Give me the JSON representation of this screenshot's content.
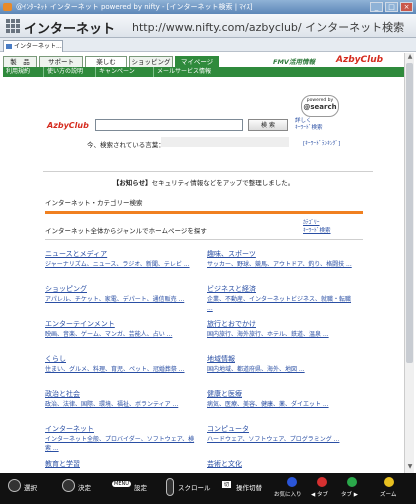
{
  "window": {
    "title": "@ｲﾝﾀｰﾈｯﾄ インターネット powered by nifty - [インターネット検索 | ﾏｲｽ]"
  },
  "address": {
    "brand": "インターネット",
    "url": "http://www.nifty.com/azbyclub/ インターネット検索"
  },
  "browser_tab": {
    "label": "インターネット..."
  },
  "nav": {
    "items": [
      "製　品",
      "サポート",
      "楽しむ",
      "ショッピング",
      "マイページ"
    ],
    "fmv_label": "FMV活用情報",
    "brand": "AzbyClub"
  },
  "subnav": {
    "items": [
      "利用規約",
      "使い方の説明",
      "キャンペーン",
      "メールサービス情報"
    ]
  },
  "search": {
    "logo": "AzbyClub",
    "input_value": "",
    "button_label": "検 索",
    "links": [
      "詳しく",
      "ｷｰﾜｰﾄﾞ検索"
    ],
    "powered_top": "powered by",
    "powered_brand": "@search",
    "current_label": "今、検索されている言葉：",
    "ranking_link": "[ｷｰﾜｰﾄﾞﾗﾝｷﾝｸﾞ]"
  },
  "notice": {
    "prefix": "【お知らせ】",
    "text": "セキュリティ情報などをアップで整理しました。"
  },
  "category": {
    "heading": "インターネット・カテゴリー検索",
    "intro": "インターネット全体からジャンルでホームページを探す",
    "top_links": [
      "ｶﾃｺﾞﾘｰ",
      "ｷｰﾜｰﾄﾞ検索"
    ],
    "items": [
      {
        "title": "ニュースとメディア",
        "links": "ジャーナリズム、ニュース、ラジオ、新聞、テレビ ..."
      },
      {
        "title": "趣味、スポーツ",
        "links": "サッカー、野球、競馬、アウトドア、釣り、格闘技 ..."
      },
      {
        "title": "ショッピング",
        "links": "アパレル、チケット、家電、デパート、通信販売 ..."
      },
      {
        "title": "ビジネスと経済",
        "links": "企業、不動産、インターネットビジネス、就職・転職 ..."
      },
      {
        "title": "エンターテインメント",
        "links": "映画、音楽、ゲーム、マンガ、芸能人、占い ..."
      },
      {
        "title": "旅行とおでかけ",
        "links": "国内旅行、海外旅行、ホテル、鉄道、温泉 ..."
      },
      {
        "title": "くらし",
        "links": "住まい、グルメ、料理、育児、ペット、冠婚葬祭 ..."
      },
      {
        "title": "地域情報",
        "links": "国内地域、都道府県、海外、地図 ..."
      },
      {
        "title": "政治と社会",
        "links": "政治、法律、国際、環境、福祉、ボランティア ..."
      },
      {
        "title": "健康と医療",
        "links": "病気、医療、美容、健康、薬、ダイエット ..."
      },
      {
        "title": "インターネット",
        "links": "インターネット全般、プロバイダー、ソフトウェア、検索 ..."
      },
      {
        "title": "コンピュータ",
        "links": "ハードウェア、ソフトウェア、プログラミング ..."
      },
      {
        "title": "教育と学習",
        "links": ""
      },
      {
        "title": "芸術と文化",
        "links": ""
      }
    ]
  },
  "footer": {
    "select_label": "選択",
    "confirm_label": "決定",
    "settings_badge": "MENU",
    "settings_label": "設定",
    "scroll_label": "スクロール",
    "switch_badge": "切",
    "switch_label": "操作切替",
    "favorites_label": "お気に入り",
    "tab_prev_label": "◀ タブ",
    "tab_next_label": "タブ ▶",
    "zoom_label": "ズーム",
    "colors": {
      "blue": "#2a55d8",
      "red": "#d63030",
      "green": "#2aa84a",
      "yellow": "#e8c020"
    }
  }
}
